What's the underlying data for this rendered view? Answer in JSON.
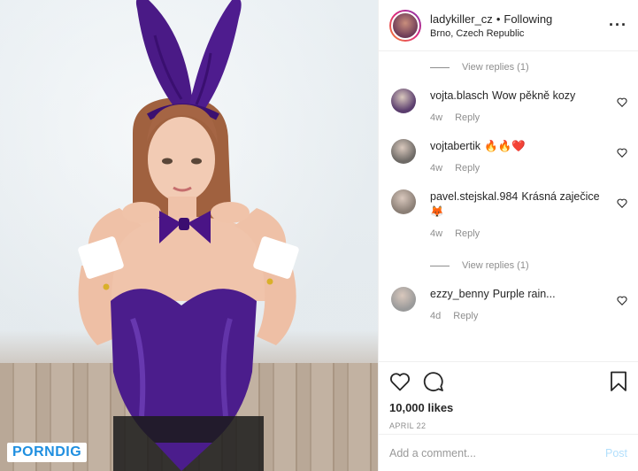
{
  "post": {
    "username": "ladykiller_cz",
    "separator": "•",
    "follow_state": "Following",
    "location": "Brno, Czech Republic",
    "more_icon": "more-horizontal-icon"
  },
  "media": {
    "watermark": "PORNDIG",
    "description_icon": "photo"
  },
  "comments": [
    {
      "type": "view_replies",
      "label": "View replies (1)"
    },
    {
      "type": "comment",
      "username": "vojta.blasch",
      "text": "Wow pěkně kozy",
      "age": "4w",
      "reply_label": "Reply",
      "avatar_color": "#5b3e6e"
    },
    {
      "type": "comment",
      "username": "vojtabertik",
      "text": "🔥🔥❤️",
      "age": "4w",
      "reply_label": "Reply",
      "avatar_color": "#6e6a66"
    },
    {
      "type": "comment",
      "username": "pavel.stejskal.984",
      "text": "Krásná zaječice 🦊",
      "age": "4w",
      "reply_label": "Reply",
      "avatar_color": "#8b7f76"
    },
    {
      "type": "view_replies",
      "label": "View replies (1)"
    },
    {
      "type": "comment",
      "username": "ezzy_benny",
      "text": "Purple rain...",
      "age": "4d",
      "reply_label": "Reply",
      "avatar_color": "#9a9a9a"
    }
  ],
  "actions": {
    "likes": "10,000 likes",
    "date": "APRIL 22"
  },
  "add_comment": {
    "placeholder": "Add a comment...",
    "post_label": "Post"
  },
  "colors": {
    "text": "#262626",
    "muted": "#8e8e8e",
    "post_disabled": "#b2dffc",
    "watermark": "#1f8fe0",
    "costume_purple": "#4b1d8c"
  }
}
